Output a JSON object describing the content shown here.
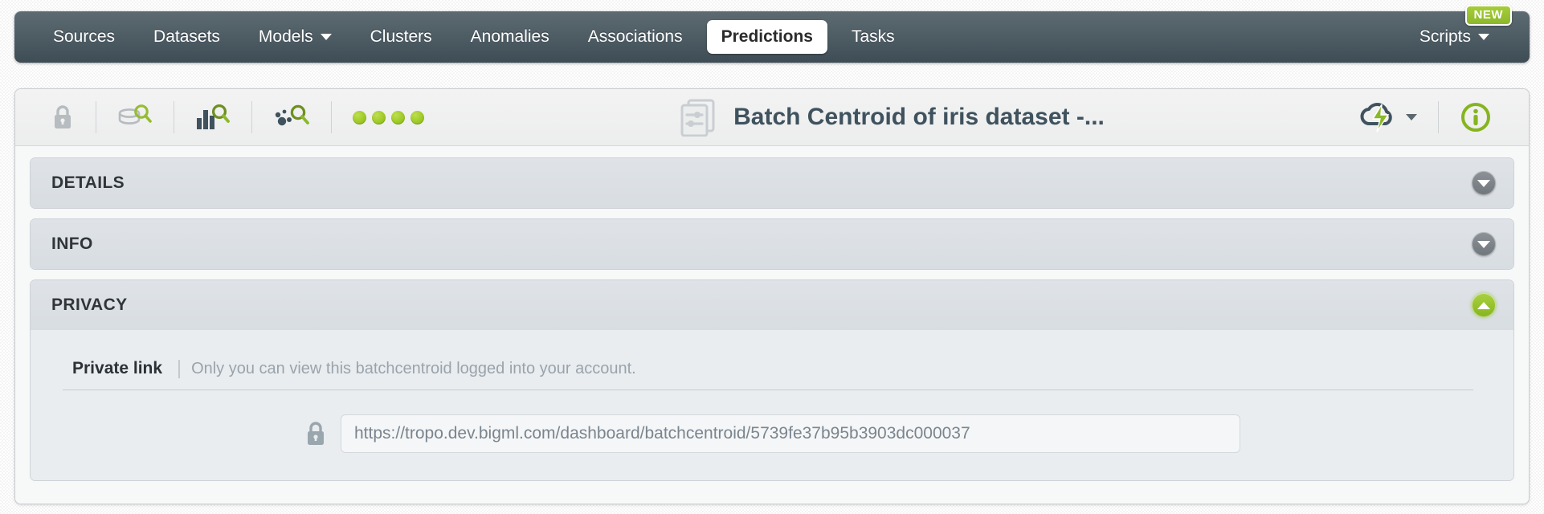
{
  "nav": {
    "items": [
      {
        "label": "Sources",
        "icon": "",
        "active": false,
        "caret": false
      },
      {
        "label": "Datasets",
        "icon": "",
        "active": false,
        "caret": false
      },
      {
        "label": "Models",
        "icon": "chevron-down-icon",
        "active": false,
        "caret": true
      },
      {
        "label": "Clusters",
        "icon": "",
        "active": false,
        "caret": false
      },
      {
        "label": "Anomalies",
        "icon": "",
        "active": false,
        "caret": false
      },
      {
        "label": "Associations",
        "icon": "",
        "active": false,
        "caret": false
      },
      {
        "label": "Predictions",
        "icon": "",
        "active": true,
        "caret": false
      },
      {
        "label": "Tasks",
        "icon": "",
        "active": false,
        "caret": false
      }
    ],
    "right_item": {
      "label": "Scripts",
      "caret": true
    },
    "badge": "NEW",
    "accent_green": "#8cb82b",
    "bar_color": "#4b5962"
  },
  "toolbar": {
    "left_icons": [
      {
        "name": "lock-icon",
        "title": "Private"
      },
      {
        "name": "dataset-search-icon",
        "title": "Dataset"
      },
      {
        "name": "model-search-icon",
        "title": "Model"
      },
      {
        "name": "cluster-search-icon",
        "title": "Cluster"
      }
    ],
    "status_dots": 4,
    "status_dot_color": "#9cc824",
    "resource_icon": "batch-centroid-icon",
    "title": "Batch Centroid of iris dataset -...",
    "right_icons": [
      {
        "name": "cloud-action-icon",
        "caret": true
      },
      {
        "name": "info-circle-icon",
        "caret": false
      }
    ]
  },
  "sections": [
    {
      "id": "details",
      "label": "DETAILS",
      "expanded": false
    },
    {
      "id": "info",
      "label": "INFO",
      "expanded": false
    },
    {
      "id": "privacy",
      "label": "PRIVACY",
      "expanded": true
    }
  ],
  "privacy": {
    "link_label": "Private link",
    "link_description": "Only you can view this batchcentroid logged into your account.",
    "lock_icon": "lock-icon",
    "url_value": "https://tropo.dev.bigml.com/dashboard/batchcentroid/5739fe37b95b3903dc000037",
    "url_placeholder": "Private link URL"
  }
}
